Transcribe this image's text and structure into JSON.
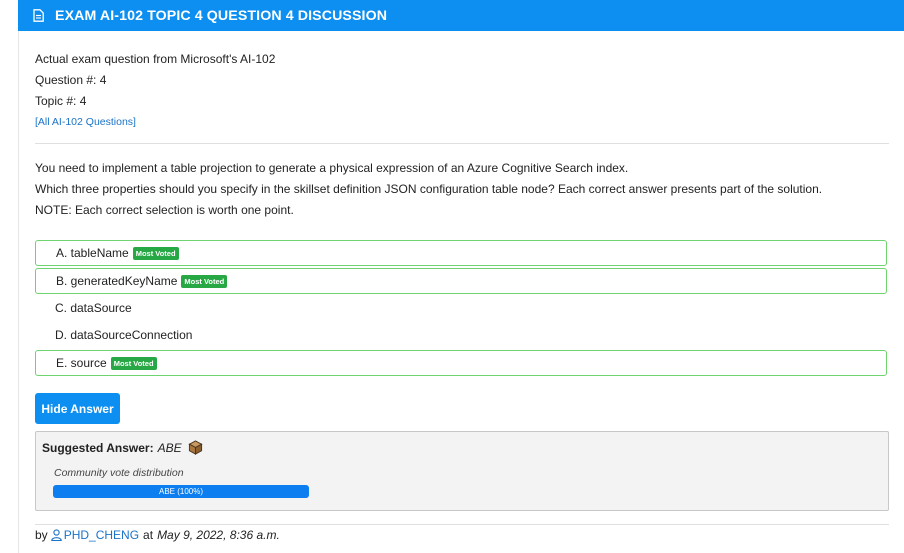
{
  "header": {
    "title": "EXAM AI-102 TOPIC 4 QUESTION 4 DISCUSSION",
    "icon": "document-icon"
  },
  "meta": {
    "source": "Actual exam question from Microsoft's AI-102",
    "question_number": "Question #: 4",
    "topic_number": "Topic #: 4",
    "all_questions_link": "[All AI-102 Questions]"
  },
  "question": {
    "line1": "You need to implement a table projection to generate a physical expression of an Azure Cognitive Search index.",
    "line2": "Which three properties should you specify in the skillset definition JSON configuration table node? Each correct answer presents part of the solution.",
    "line3": "NOTE: Each correct selection is worth one point."
  },
  "choices": [
    {
      "label": "A. tableName",
      "badge": "Most Voted"
    },
    {
      "label": "B. generatedKeyName",
      "badge": "Most Voted"
    },
    {
      "label": "C. dataSource"
    },
    {
      "label": "D. dataSourceConnection"
    },
    {
      "label": "E. source",
      "badge": "Most Voted"
    }
  ],
  "hide_answer_button": "Hide Answer",
  "suggested_answer": {
    "label": "Suggested Answer:",
    "value": "ABE",
    "vote_label": "Community vote distribution",
    "vote_bar": "ABE (100%)",
    "vote_share": 1.0
  },
  "footer": {
    "by": "by",
    "user": "PHD_CHENG",
    "at": "at",
    "date": "May 9, 2022, 8:36 a.m."
  },
  "colors": {
    "accent": "#0c8ff0",
    "badge": "#28a745",
    "link": "#1a73c8",
    "voted_border": "#6fd36f"
  }
}
